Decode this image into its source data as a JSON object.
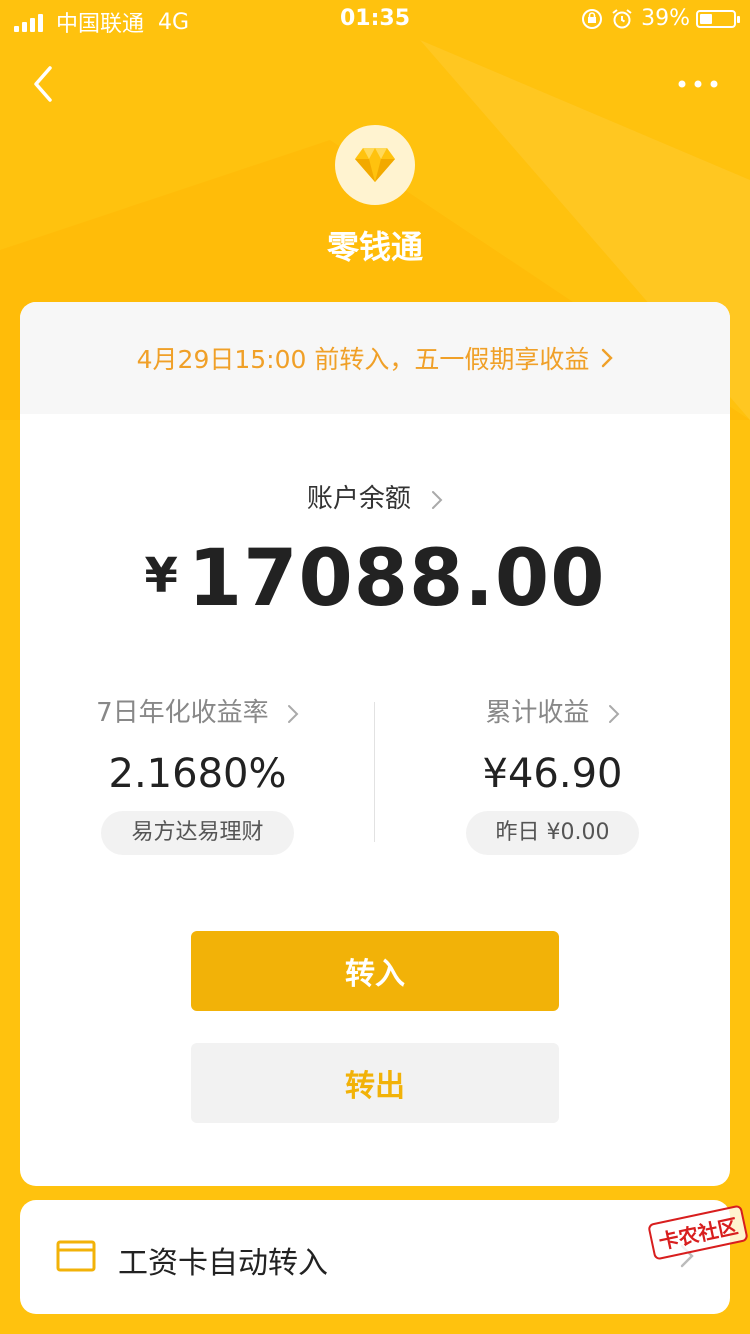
{
  "status_bar": {
    "carrier": "中国联通",
    "network": "4G",
    "time": "01:35",
    "battery_text": "39%",
    "battery_level": 0.39
  },
  "header": {
    "title": "零钱通"
  },
  "banner": {
    "text": "4月29日15:00 前转入，五一假期享收益"
  },
  "balance": {
    "label": "账户余额",
    "currency": "¥",
    "amount": "17088.00"
  },
  "stats": {
    "yield_label": "7日年化收益率",
    "yield_value": "2.1680%",
    "fund_name": "易方达易理财",
    "income_label": "累计收益",
    "income_value": "¥46.90",
    "yesterday": "昨日 ¥0.00"
  },
  "buttons": {
    "transfer_in": "转入",
    "transfer_out": "转出"
  },
  "auto_transfer": {
    "label": "工资卡自动转入"
  },
  "watermark": "卡农社区",
  "colors": {
    "brand_yellow": "#FFC20E",
    "button_yellow": "#F2B208",
    "banner_orange": "#F0A028"
  }
}
